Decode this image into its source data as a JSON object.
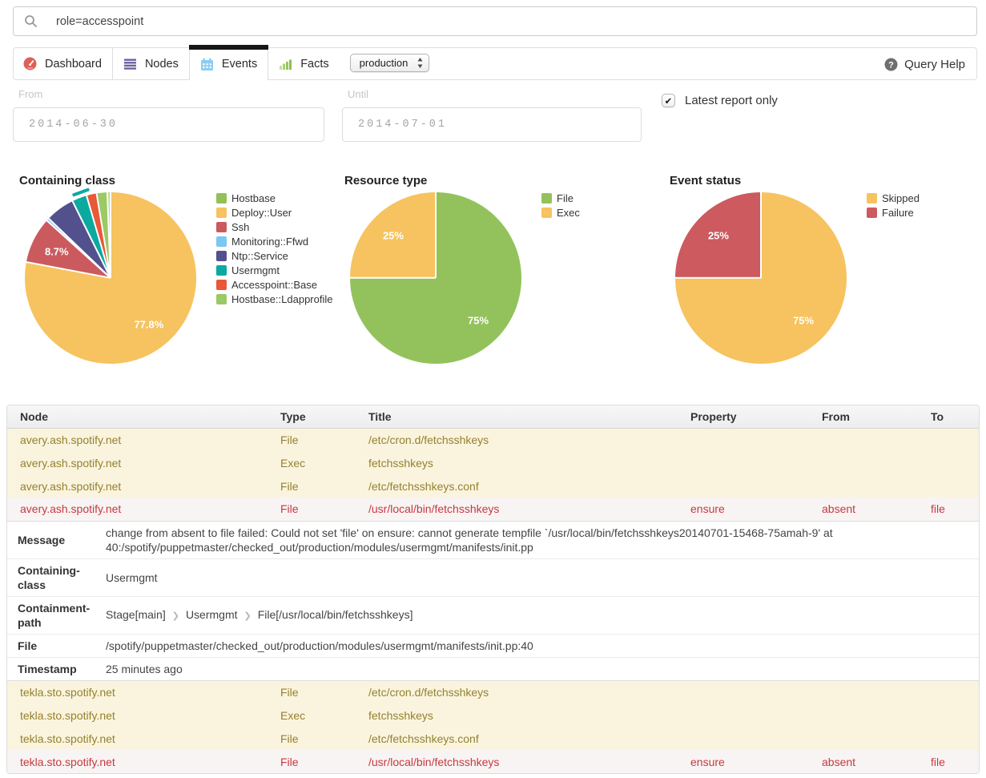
{
  "search": {
    "value": "role=accesspoint"
  },
  "nav": {
    "tabs": [
      {
        "label": "Dashboard",
        "icon": "gauge-icon",
        "active": false
      },
      {
        "label": "Nodes",
        "icon": "list-icon",
        "active": false
      },
      {
        "label": "Events",
        "icon": "calendar-icon",
        "active": true
      },
      {
        "label": "Facts",
        "icon": "bar-chart-icon",
        "active": false
      }
    ],
    "environment_select": {
      "value": "production"
    },
    "query_help_label": "Query Help"
  },
  "filters": {
    "from_label": "From",
    "from_value": "2014-06-30",
    "until_label": "Until",
    "until_value": "2014-07-01",
    "latest_label": "Latest report only",
    "latest_checked": true
  },
  "chart_data": [
    {
      "type": "pie",
      "title": "Containing class",
      "slices": [
        {
          "label": "Deploy::User",
          "value": 77.8,
          "color": "#f6c360",
          "show_label": true
        },
        {
          "label": "Ssh",
          "value": 8.7,
          "color": "#cb5a5e",
          "show_label": true
        },
        {
          "label": "Monitoring::Ffwd",
          "value": 0.5,
          "color": "#7cc8f0"
        },
        {
          "label": "Ntp::Service",
          "value": 5.5,
          "color": "#52518e"
        },
        {
          "label": "Usermgmt",
          "value": 2.8,
          "color": "#0ca9a1"
        },
        {
          "label": "Accesspoint::Base",
          "value": 1.9,
          "color": "#e95839"
        },
        {
          "label": "Hostbase::Ldapprofile",
          "value": 2.0,
          "color": "#9bc964"
        },
        {
          "label": "Hostbase",
          "value": 0.6,
          "color": "#b5d98b",
          "legend_color": "#92c158"
        }
      ],
      "legend_order": [
        7,
        0,
        1,
        2,
        3,
        4,
        5,
        6
      ]
    },
    {
      "type": "pie",
      "title": "Resource type",
      "slices": [
        {
          "label": "File",
          "value": 75,
          "color": "#93c25c",
          "show_label": true
        },
        {
          "label": "Exec",
          "value": 25,
          "color": "#f6c360",
          "show_label": true
        }
      ],
      "legend_order": [
        0,
        1
      ]
    },
    {
      "type": "pie",
      "title": "Event status",
      "slices": [
        {
          "label": "Skipped",
          "value": 75,
          "color": "#f6c360",
          "show_label": true
        },
        {
          "label": "Failure",
          "value": 25,
          "color": "#cc5a5e",
          "show_label": true
        }
      ],
      "legend_order": [
        0,
        1
      ]
    }
  ],
  "events_table": {
    "columns": [
      "Node",
      "Type",
      "Title",
      "Property",
      "From",
      "To"
    ],
    "rows": [
      {
        "node": "avery.ash.spotify.net",
        "type": "File",
        "title": "/etc/cron.d/fetchsshkeys",
        "property": "",
        "from": "",
        "to": "",
        "status": "skipped"
      },
      {
        "node": "avery.ash.spotify.net",
        "type": "Exec",
        "title": "fetchsshkeys",
        "property": "",
        "from": "",
        "to": "",
        "status": "skipped"
      },
      {
        "node": "avery.ash.spotify.net",
        "type": "File",
        "title": "/etc/fetchsshkeys.conf",
        "property": "",
        "from": "",
        "to": "",
        "status": "skipped"
      },
      {
        "node": "avery.ash.spotify.net",
        "type": "File",
        "title": "/usr/local/bin/fetchsshkeys",
        "property": "ensure",
        "from": "absent",
        "to": "file",
        "status": "failure",
        "details": [
          {
            "label": "Message",
            "value": "change from absent to file failed: Could not set 'file' on ensure: cannot generate tempfile `/usr/local/bin/fetchsshkeys20140701-15468-75amah-9' at 40:/spotify/puppetmaster/checked_out/production/modules/usermgmt/manifests/init.pp"
          },
          {
            "label": "Containing-class",
            "value": "Usermgmt"
          },
          {
            "label": "Containment-path",
            "path": [
              "Stage[main]",
              "Usermgmt",
              "File[/usr/local/bin/fetchsshkeys]"
            ]
          },
          {
            "label": "File",
            "value": "/spotify/puppetmaster/checked_out/production/modules/usermgmt/manifests/init.pp:40"
          },
          {
            "label": "Timestamp",
            "value": "25 minutes ago"
          }
        ]
      },
      {
        "node": "tekla.sto.spotify.net",
        "type": "File",
        "title": "/etc/cron.d/fetchsshkeys",
        "property": "",
        "from": "",
        "to": "",
        "status": "skipped"
      },
      {
        "node": "tekla.sto.spotify.net",
        "type": "Exec",
        "title": "fetchsshkeys",
        "property": "",
        "from": "",
        "to": "",
        "status": "skipped"
      },
      {
        "node": "tekla.sto.spotify.net",
        "type": "File",
        "title": "/etc/fetchsshkeys.conf",
        "property": "",
        "from": "",
        "to": "",
        "status": "skipped"
      },
      {
        "node": "tekla.sto.spotify.net",
        "type": "File",
        "title": "/usr/local/bin/fetchsshkeys",
        "property": "ensure",
        "from": "absent",
        "to": "file",
        "status": "failure"
      }
    ]
  }
}
